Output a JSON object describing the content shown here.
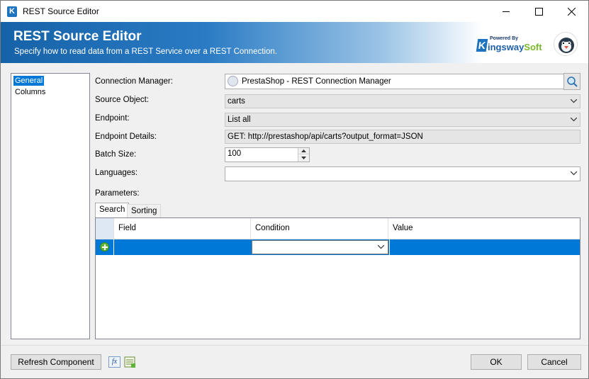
{
  "window": {
    "title": "REST Source Editor"
  },
  "banner": {
    "title": "REST Source Editor",
    "subtitle": "Specify how to read data from a REST Service over a REST Connection.",
    "logo_powered": "Powered By",
    "logo_name_a": "ingsway",
    "logo_name_b": "Soft",
    "logo_k": "K"
  },
  "nav": {
    "items": [
      {
        "label": "General",
        "selected": true
      },
      {
        "label": "Columns",
        "selected": false
      }
    ]
  },
  "form": {
    "connection_manager": {
      "label": "Connection Manager:",
      "value": "PrestaShop - REST Connection Manager"
    },
    "source_object": {
      "label": "Source Object:",
      "value": "carts"
    },
    "endpoint": {
      "label": "Endpoint:",
      "value": "List all"
    },
    "endpoint_details": {
      "label": "Endpoint Details:",
      "value": "GET: http://prestashop/api/carts?output_format=JSON"
    },
    "batch_size": {
      "label": "Batch Size:",
      "value": "100"
    },
    "languages": {
      "label": "Languages:",
      "value": ""
    },
    "parameters": {
      "label": "Parameters:"
    }
  },
  "tabs": [
    {
      "label": "Search",
      "active": true
    },
    {
      "label": "Sorting",
      "active": false
    }
  ],
  "grid": {
    "columns": [
      "Field",
      "Condition",
      "Value"
    ],
    "rows": [
      {
        "field": "",
        "condition": "",
        "value": ""
      }
    ]
  },
  "footer": {
    "refresh_label": "Refresh Component",
    "fx_label": "fx",
    "ok_label": "OK",
    "cancel_label": "Cancel"
  },
  "colors": {
    "accent": "#0078d7",
    "banner_start": "#1662a8",
    "add_green": "#5fb336"
  },
  "icons": [
    "app-icon",
    "minimize-icon",
    "maximize-icon",
    "close-icon",
    "prestashop-icon",
    "search-icon",
    "chevron-down-icon",
    "add-row-icon",
    "fx-icon",
    "variables-icon"
  ]
}
